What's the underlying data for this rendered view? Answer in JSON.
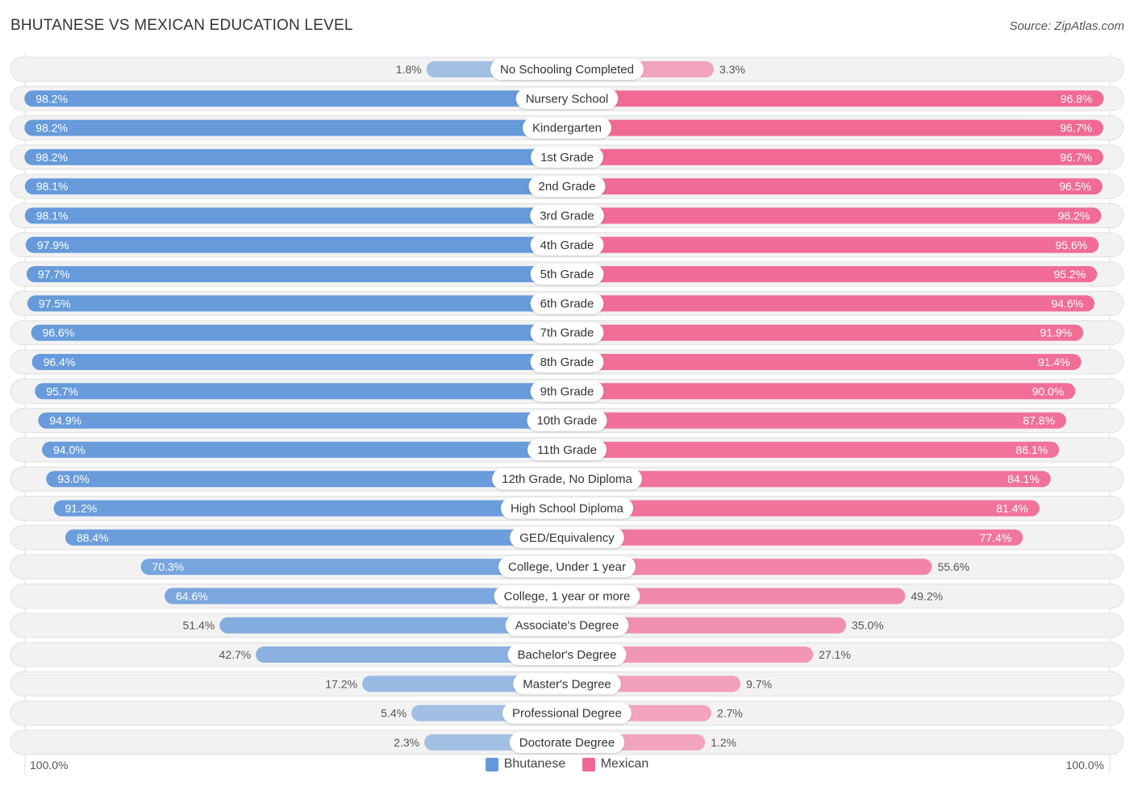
{
  "title": "BHUTANESE VS MEXICAN EDUCATION LEVEL",
  "source": "Source: ZipAtlas.com",
  "colors": {
    "bhutanese": "#6499da",
    "mexican": "#f06893"
  },
  "chart_data": {
    "type": "bar",
    "orientation": "horizontal-diverging",
    "title": "BHUTANESE VS MEXICAN EDUCATION LEVEL",
    "categories": [
      "No Schooling Completed",
      "Nursery School",
      "Kindergarten",
      "1st Grade",
      "2nd Grade",
      "3rd Grade",
      "4th Grade",
      "5th Grade",
      "6th Grade",
      "7th Grade",
      "8th Grade",
      "9th Grade",
      "10th Grade",
      "11th Grade",
      "12th Grade, No Diploma",
      "High School Diploma",
      "GED/Equivalency",
      "College, Under 1 year",
      "College, 1 year or more",
      "Associate's Degree",
      "Bachelor's Degree",
      "Master's Degree",
      "Professional Degree",
      "Doctorate Degree"
    ],
    "series": [
      {
        "name": "Bhutanese",
        "side": "left",
        "values": [
          1.8,
          98.2,
          98.2,
          98.2,
          98.1,
          98.1,
          97.9,
          97.7,
          97.5,
          96.6,
          96.4,
          95.7,
          94.9,
          94.0,
          93.0,
          91.2,
          88.4,
          70.3,
          64.6,
          51.4,
          42.7,
          17.2,
          5.4,
          2.3
        ]
      },
      {
        "name": "Mexican",
        "side": "right",
        "values": [
          3.3,
          96.8,
          96.7,
          96.7,
          96.5,
          96.2,
          95.6,
          95.2,
          94.6,
          91.9,
          91.4,
          90.0,
          87.8,
          86.1,
          84.1,
          81.4,
          77.4,
          55.6,
          49.2,
          35.0,
          27.1,
          9.7,
          2.7,
          1.2
        ]
      }
    ],
    "value_format": "{v}%",
    "xlim": [
      0,
      100
    ],
    "axis_labels": {
      "left": "100.0%",
      "right": "100.0%"
    },
    "legend": {
      "position": "bottom-center",
      "entries": [
        "Bhutanese",
        "Mexican"
      ]
    },
    "grid": false
  }
}
